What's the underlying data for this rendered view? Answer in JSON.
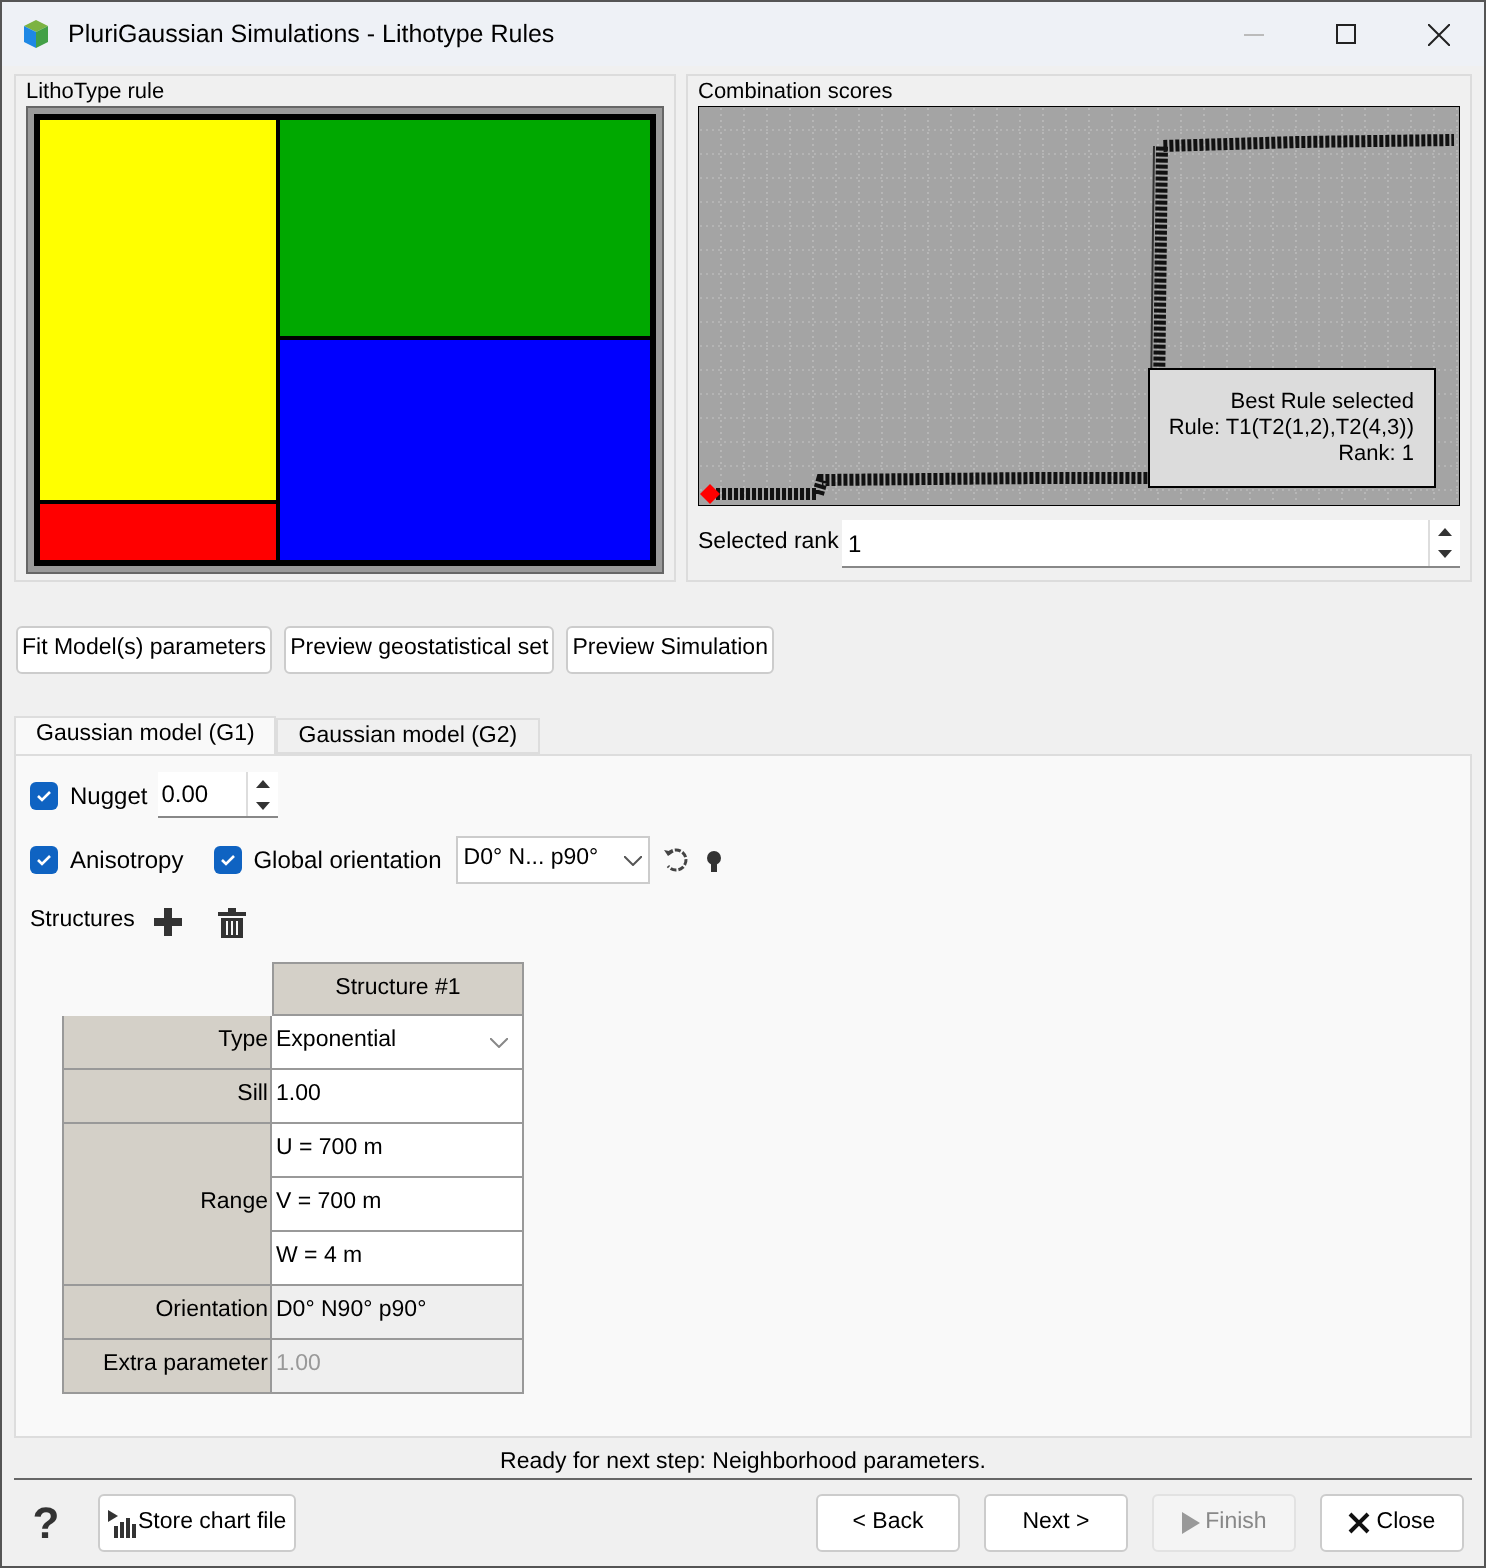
{
  "window": {
    "title": "PluriGaussian Simulations - Lithotype Rules"
  },
  "lithotype_rule": {
    "title": "LithoType rule",
    "facies": [
      {
        "color": "#ffff00"
      },
      {
        "color": "#ff0000"
      },
      {
        "color": "#00a800"
      },
      {
        "color": "#0000ff"
      }
    ]
  },
  "combination_scores": {
    "title": "Combination scores",
    "legend": [
      "Best Rule selected",
      "Rule: T1(T2(1,2),T2(4,3))",
      "Rank: 1"
    ],
    "selected_rank_label": "Selected rank",
    "selected_rank": "1"
  },
  "action_buttons": [
    "Fit Model(s) parameters",
    "Preview geostatistical set",
    "Preview Simulation"
  ],
  "tabs": [
    {
      "label": "Gaussian model (G1)",
      "selected": true
    },
    {
      "label": "Gaussian model (G2)",
      "selected": false
    }
  ],
  "nugget": {
    "label": "Nugget",
    "checked": true,
    "value": "0.00"
  },
  "anisotropy": {
    "label": "Anisotropy",
    "checked": true
  },
  "global_orientation": {
    "label": "Global orientation",
    "checked": true,
    "value": "D0° N... p90°"
  },
  "structures_label": "Structures",
  "structure_table": {
    "column": "Structure #1",
    "rows": [
      {
        "label": "Type",
        "kind": "select",
        "values": [
          "Exponential"
        ]
      },
      {
        "label": "Sill",
        "kind": "text",
        "values": [
          "1.00"
        ]
      },
      {
        "label": "Range",
        "kind": "text",
        "values": [
          "U = 700 m",
          "V = 700 m",
          "W = 4 m"
        ]
      },
      {
        "label": "Orientation",
        "kind": "readonly",
        "values": [
          "D0° N90° p90°"
        ]
      },
      {
        "label": "Extra parameter",
        "kind": "disabled",
        "values": [
          "1.00"
        ]
      }
    ]
  },
  "status": "Ready for next step: Neighborhood parameters.",
  "footer": {
    "help": "?",
    "store": "Store chart file",
    "buttons": [
      {
        "label": "< Back",
        "kind": "plain",
        "disabled": false
      },
      {
        "label": "Next >",
        "kind": "plain",
        "disabled": false
      },
      {
        "label": "Finish",
        "kind": "play",
        "disabled": true
      },
      {
        "label": "Close",
        "kind": "close",
        "disabled": false
      }
    ]
  }
}
